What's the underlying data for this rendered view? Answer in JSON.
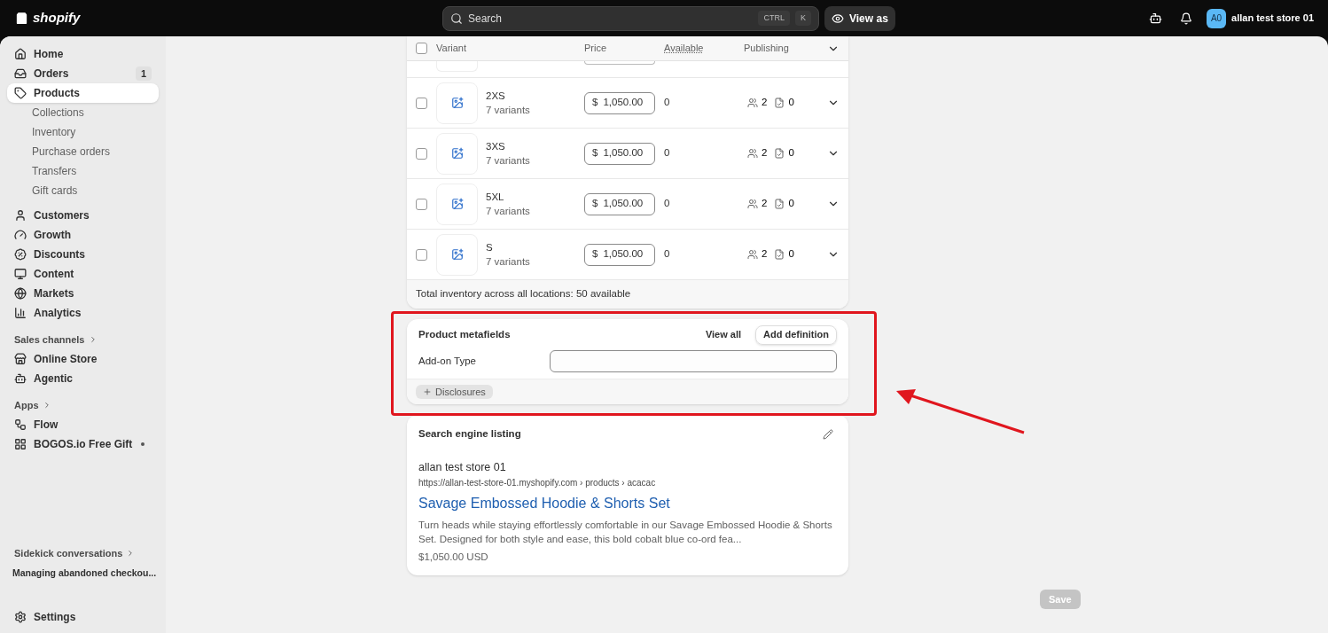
{
  "topbar": {
    "logo_text": "shopify",
    "search": {
      "placeholder": "Search",
      "keys": [
        "CTRL",
        "K"
      ]
    },
    "view_as": "View as",
    "store": {
      "initials": "A0",
      "name": "allan test store 01"
    }
  },
  "sidebar": {
    "main": [
      {
        "label": "Home",
        "selected": false
      },
      {
        "label": "Orders",
        "selected": false,
        "badge": "1"
      },
      {
        "label": "Products",
        "selected": true,
        "children": [
          {
            "label": "Collections"
          },
          {
            "label": "Inventory"
          },
          {
            "label": "Purchase orders"
          },
          {
            "label": "Transfers"
          },
          {
            "label": "Gift cards"
          }
        ]
      }
    ],
    "secondary": [
      {
        "label": "Customers",
        "selected": false
      },
      {
        "label": "Growth",
        "selected": false
      },
      {
        "label": "Discounts",
        "selected": false
      },
      {
        "label": "Content",
        "selected": false
      },
      {
        "label": "Markets",
        "selected": false
      },
      {
        "label": "Analytics",
        "selected": false
      }
    ],
    "sections": [
      {
        "heading": "Sales channels",
        "items": [
          {
            "label": "Online Store",
            "selected": false,
            "dot": false
          },
          {
            "label": "Agentic",
            "selected": false,
            "dot": false
          }
        ]
      },
      {
        "heading": "Apps",
        "items": [
          {
            "label": "Flow",
            "selected": false,
            "dot": false
          },
          {
            "label": "BOGOS.io Free Gift",
            "selected": false,
            "dot": true
          }
        ]
      }
    ],
    "sidekick": {
      "heading": "Sidekick conversations",
      "items": [
        "Managing abandoned checkou..."
      ]
    },
    "settings": "Settings"
  },
  "variants_table": {
    "select_all_checked": false,
    "columns": [
      "Variant",
      "Price",
      "Available",
      "Publishing"
    ],
    "rows": [
      {
        "name": "2XS",
        "subtitle": "7 variants",
        "currency": "$",
        "price": "1,050.00",
        "available": "0",
        "channels": "2",
        "markets": "0",
        "checked": false
      },
      {
        "name": "3XS",
        "subtitle": "7 variants",
        "currency": "$",
        "price": "1,050.00",
        "available": "0",
        "channels": "2",
        "markets": "0",
        "checked": false
      },
      {
        "name": "5XL",
        "subtitle": "7 variants",
        "currency": "$",
        "price": "1,050.00",
        "available": "0",
        "channels": "2",
        "markets": "0",
        "checked": false
      },
      {
        "name": "S",
        "subtitle": "7 variants",
        "currency": "$",
        "price": "1,050.00",
        "available": "0",
        "channels": "2",
        "markets": "0",
        "checked": false
      }
    ],
    "footer": "Total inventory across all locations: 50 available"
  },
  "metafields": {
    "title": "Product metafields",
    "view_all": "View all",
    "add_definition": "Add definition",
    "fields": [
      {
        "label": "Add-on Type"
      }
    ],
    "disclosures": "Disclosures"
  },
  "seo": {
    "title": "Search engine listing",
    "store_name": "allan test store 01",
    "url": "https://allan-test-store-01.myshopify.com › products › acacac",
    "page_title": "Savage Embossed Hoodie & Shorts Set",
    "description": "Turn heads while staying effortlessly comfortable in our Savage Embossed Hoodie & Shorts Set. Designed for both style and ease, this bold cobalt blue co-ord fea...",
    "price": "$1,050.00 USD"
  },
  "save_button": {
    "label": "Save",
    "disabled": true
  }
}
